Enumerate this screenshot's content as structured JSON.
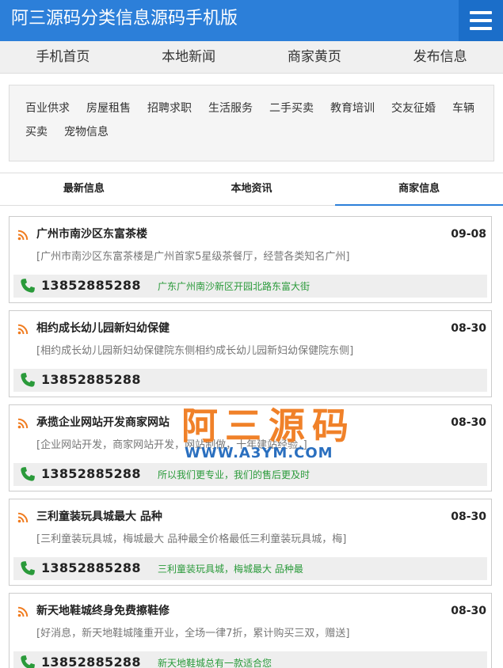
{
  "header": {
    "title": "阿三源码分类信息源码手机版"
  },
  "nav": [
    {
      "label": "手机首页"
    },
    {
      "label": "本地新闻"
    },
    {
      "label": "商家黄页"
    },
    {
      "label": "发布信息"
    }
  ],
  "categories": [
    "百业供求",
    "房屋租售",
    "招聘求职",
    "生活服务",
    "二手买卖",
    "教育培训",
    "交友征婚",
    "车辆",
    "买卖",
    "宠物信息"
  ],
  "tabs": [
    {
      "label": "最新信息",
      "active": false
    },
    {
      "label": "本地资讯",
      "active": false
    },
    {
      "label": "商家信息",
      "active": true
    }
  ],
  "listings": [
    {
      "title": "广州市南沙区东富茶楼",
      "date": "09-08",
      "desc": "[广州市南沙区东富茶楼是广州首家5星级茶餐厅，经营各类知名广州]",
      "phone": "13852885288",
      "address": "广东广州南沙新区开园北路东富大街"
    },
    {
      "title": "相约成长幼儿园新妇幼保健",
      "date": "08-30",
      "desc": "[相约成长幼儿园新妇幼保健院东侧相约成长幼儿园新妇幼保健院东侧]",
      "phone": "13852885288",
      "address": ""
    },
    {
      "title": "承揽企业网站开发商家网站",
      "date": "08-30",
      "desc": "[企业网站开发，商家网站开发，网站制做，十年建站经验，]",
      "phone": "13852885288",
      "address": "所以我们更专业，我们的售后更及时"
    },
    {
      "title": "三利童装玩具城最大 品种",
      "date": "08-30",
      "desc": "[三利童装玩具城，梅城最大 品种最全价格最低三利童装玩具城，梅]",
      "phone": "13852885288",
      "address": "三利童装玩具城，梅城最大 品种最"
    },
    {
      "title": "新天地鞋城终身免费擦鞋修",
      "date": "08-30",
      "desc": "[好消息，新天地鞋城隆重开业，全场一律7折，累计购买三双，赠送]",
      "phone": "13852885288",
      "address": "新天地鞋城总有一款适合您"
    }
  ],
  "watermark": {
    "cn": "阿三源码",
    "en": "WWW.A3YM.COM"
  },
  "colors": {
    "brand": "#2c7fd9",
    "rss": "#f07b1e",
    "phone": "#2a9a3a",
    "address": "#2a9a3a"
  }
}
